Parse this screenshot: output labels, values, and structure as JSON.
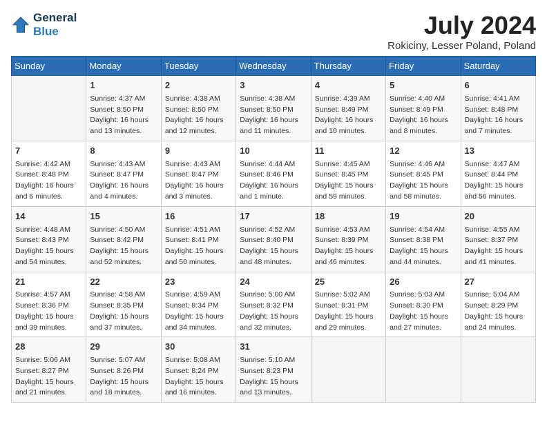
{
  "header": {
    "logo_line1": "General",
    "logo_line2": "Blue",
    "month_title": "July 2024",
    "location": "Rokiciny, Lesser Poland, Poland"
  },
  "days_of_week": [
    "Sunday",
    "Monday",
    "Tuesday",
    "Wednesday",
    "Thursday",
    "Friday",
    "Saturday"
  ],
  "weeks": [
    [
      {
        "day": "",
        "info": ""
      },
      {
        "day": "1",
        "info": "Sunrise: 4:37 AM\nSunset: 8:50 PM\nDaylight: 16 hours\nand 13 minutes."
      },
      {
        "day": "2",
        "info": "Sunrise: 4:38 AM\nSunset: 8:50 PM\nDaylight: 16 hours\nand 12 minutes."
      },
      {
        "day": "3",
        "info": "Sunrise: 4:38 AM\nSunset: 8:50 PM\nDaylight: 16 hours\nand 11 minutes."
      },
      {
        "day": "4",
        "info": "Sunrise: 4:39 AM\nSunset: 8:49 PM\nDaylight: 16 hours\nand 10 minutes."
      },
      {
        "day": "5",
        "info": "Sunrise: 4:40 AM\nSunset: 8:49 PM\nDaylight: 16 hours\nand 8 minutes."
      },
      {
        "day": "6",
        "info": "Sunrise: 4:41 AM\nSunset: 8:48 PM\nDaylight: 16 hours\nand 7 minutes."
      }
    ],
    [
      {
        "day": "7",
        "info": "Sunrise: 4:42 AM\nSunset: 8:48 PM\nDaylight: 16 hours\nand 6 minutes."
      },
      {
        "day": "8",
        "info": "Sunrise: 4:43 AM\nSunset: 8:47 PM\nDaylight: 16 hours\nand 4 minutes."
      },
      {
        "day": "9",
        "info": "Sunrise: 4:43 AM\nSunset: 8:47 PM\nDaylight: 16 hours\nand 3 minutes."
      },
      {
        "day": "10",
        "info": "Sunrise: 4:44 AM\nSunset: 8:46 PM\nDaylight: 16 hours\nand 1 minute."
      },
      {
        "day": "11",
        "info": "Sunrise: 4:45 AM\nSunset: 8:45 PM\nDaylight: 15 hours\nand 59 minutes."
      },
      {
        "day": "12",
        "info": "Sunrise: 4:46 AM\nSunset: 8:45 PM\nDaylight: 15 hours\nand 58 minutes."
      },
      {
        "day": "13",
        "info": "Sunrise: 4:47 AM\nSunset: 8:44 PM\nDaylight: 15 hours\nand 56 minutes."
      }
    ],
    [
      {
        "day": "14",
        "info": "Sunrise: 4:48 AM\nSunset: 8:43 PM\nDaylight: 15 hours\nand 54 minutes."
      },
      {
        "day": "15",
        "info": "Sunrise: 4:50 AM\nSunset: 8:42 PM\nDaylight: 15 hours\nand 52 minutes."
      },
      {
        "day": "16",
        "info": "Sunrise: 4:51 AM\nSunset: 8:41 PM\nDaylight: 15 hours\nand 50 minutes."
      },
      {
        "day": "17",
        "info": "Sunrise: 4:52 AM\nSunset: 8:40 PM\nDaylight: 15 hours\nand 48 minutes."
      },
      {
        "day": "18",
        "info": "Sunrise: 4:53 AM\nSunset: 8:39 PM\nDaylight: 15 hours\nand 46 minutes."
      },
      {
        "day": "19",
        "info": "Sunrise: 4:54 AM\nSunset: 8:38 PM\nDaylight: 15 hours\nand 44 minutes."
      },
      {
        "day": "20",
        "info": "Sunrise: 4:55 AM\nSunset: 8:37 PM\nDaylight: 15 hours\nand 41 minutes."
      }
    ],
    [
      {
        "day": "21",
        "info": "Sunrise: 4:57 AM\nSunset: 8:36 PM\nDaylight: 15 hours\nand 39 minutes."
      },
      {
        "day": "22",
        "info": "Sunrise: 4:58 AM\nSunset: 8:35 PM\nDaylight: 15 hours\nand 37 minutes."
      },
      {
        "day": "23",
        "info": "Sunrise: 4:59 AM\nSunset: 8:34 PM\nDaylight: 15 hours\nand 34 minutes."
      },
      {
        "day": "24",
        "info": "Sunrise: 5:00 AM\nSunset: 8:32 PM\nDaylight: 15 hours\nand 32 minutes."
      },
      {
        "day": "25",
        "info": "Sunrise: 5:02 AM\nSunset: 8:31 PM\nDaylight: 15 hours\nand 29 minutes."
      },
      {
        "day": "26",
        "info": "Sunrise: 5:03 AM\nSunset: 8:30 PM\nDaylight: 15 hours\nand 27 minutes."
      },
      {
        "day": "27",
        "info": "Sunrise: 5:04 AM\nSunset: 8:29 PM\nDaylight: 15 hours\nand 24 minutes."
      }
    ],
    [
      {
        "day": "28",
        "info": "Sunrise: 5:06 AM\nSunset: 8:27 PM\nDaylight: 15 hours\nand 21 minutes."
      },
      {
        "day": "29",
        "info": "Sunrise: 5:07 AM\nSunset: 8:26 PM\nDaylight: 15 hours\nand 18 minutes."
      },
      {
        "day": "30",
        "info": "Sunrise: 5:08 AM\nSunset: 8:24 PM\nDaylight: 15 hours\nand 16 minutes."
      },
      {
        "day": "31",
        "info": "Sunrise: 5:10 AM\nSunset: 8:23 PM\nDaylight: 15 hours\nand 13 minutes."
      },
      {
        "day": "",
        "info": ""
      },
      {
        "day": "",
        "info": ""
      },
      {
        "day": "",
        "info": ""
      }
    ]
  ]
}
